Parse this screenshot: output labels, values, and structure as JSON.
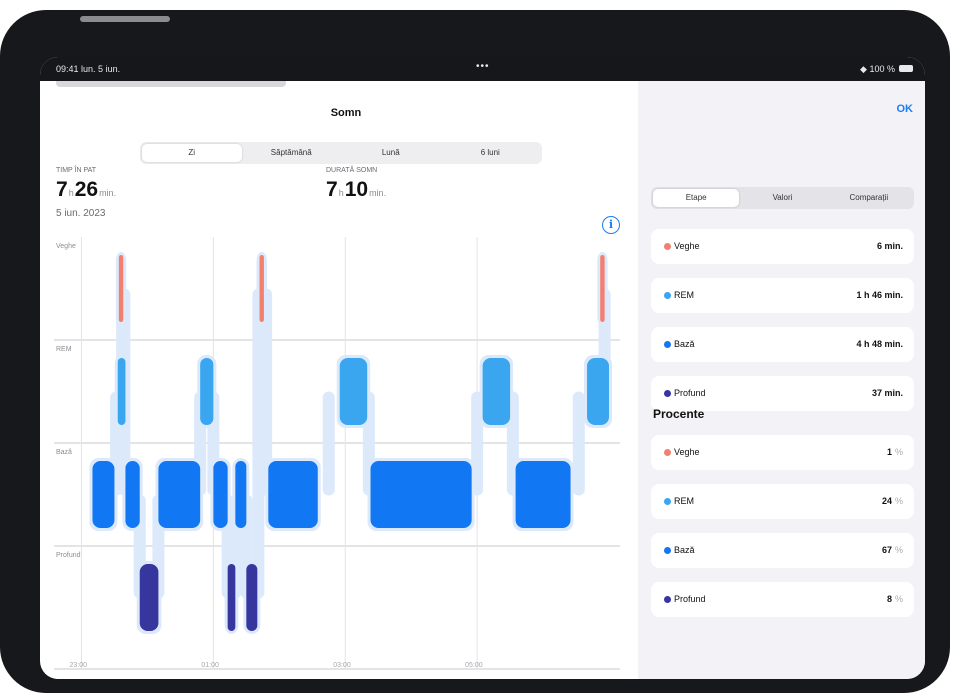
{
  "status_bar": {
    "time": "09:41",
    "date": "lun. 5 iun.",
    "dots": "•••",
    "battery": "100 %"
  },
  "sheet": {
    "title": "Somn",
    "done_label": "OK"
  },
  "periods": [
    "Zi",
    "Săptămână",
    "Lună",
    "6 luni"
  ],
  "stats": {
    "in_bed": {
      "label": "TIMP ÎN PAT",
      "hours": "7",
      "h_unit": "h",
      "minutes": "26",
      "min_unit": "min."
    },
    "asleep": {
      "label": "DURATĂ SOMN",
      "hours": "7",
      "h_unit": "h",
      "minutes": "10",
      "min_unit": "min."
    },
    "date": "5 iun. 2023"
  },
  "chart_data": {
    "type": "hypnogram",
    "stages": [
      "Veghe",
      "REM",
      "Bază",
      "Profund"
    ],
    "x_ticks": [
      "23:00",
      "01:00",
      "03:00",
      "05:00"
    ],
    "segments": [
      {
        "stage": "Veghe",
        "start": "23:34",
        "end": "23:38"
      },
      {
        "stage": "REM",
        "start": "23:33",
        "end": "23:40"
      },
      {
        "stage": "Bază",
        "start": "23:10",
        "end": "23:30"
      },
      {
        "stage": "Bază",
        "start": "23:40",
        "end": "23:53"
      },
      {
        "stage": "Profund",
        "start": "23:53",
        "end": "00:10"
      },
      {
        "stage": "Bază",
        "start": "00:10",
        "end": "00:48"
      },
      {
        "stage": "REM",
        "start": "00:48",
        "end": "01:00"
      },
      {
        "stage": "Bază",
        "start": "01:00",
        "end": "01:13"
      },
      {
        "stage": "Profund",
        "start": "01:13",
        "end": "01:20"
      },
      {
        "stage": "Bază",
        "start": "01:20",
        "end": "01:30"
      },
      {
        "stage": "Profund",
        "start": "01:30",
        "end": "01:40"
      },
      {
        "stage": "Veghe",
        "start": "01:42",
        "end": "01:46"
      },
      {
        "stage": "Bază",
        "start": "01:50",
        "end": "02:35"
      },
      {
        "stage": "REM",
        "start": "02:55",
        "end": "03:20"
      },
      {
        "stage": "Bază",
        "start": "03:23",
        "end": "04:55"
      },
      {
        "stage": "REM",
        "start": "05:05",
        "end": "05:30"
      },
      {
        "stage": "Bază",
        "start": "05:35",
        "end": "06:25"
      },
      {
        "stage": "REM",
        "start": "06:40",
        "end": "07:00"
      },
      {
        "stage": "Veghe",
        "start": "06:52",
        "end": "06:56"
      }
    ]
  },
  "tabs": [
    "Etape",
    "Valori",
    "Comparații"
  ],
  "stages_list": [
    {
      "name": "Veghe",
      "value": "6 min.",
      "color": "#f2806f"
    },
    {
      "name": "REM",
      "value": "1 h 46 min.",
      "color": "#3aa6f0"
    },
    {
      "name": "Bază",
      "value": "4 h 48 min.",
      "color": "#1277f2"
    },
    {
      "name": "Profund",
      "value": "37 min.",
      "color": "#37359e"
    }
  ],
  "percent_section": "Procente",
  "percent_list": [
    {
      "name": "Veghe",
      "value": "1",
      "unit": "%",
      "color": "#f2806f"
    },
    {
      "name": "REM",
      "value": "24",
      "unit": "%",
      "color": "#3aa6f0"
    },
    {
      "name": "Bază",
      "value": "67",
      "unit": "%",
      "color": "#1277f2"
    },
    {
      "name": "Profund",
      "value": "8",
      "unit": "%",
      "color": "#37359e"
    }
  ]
}
